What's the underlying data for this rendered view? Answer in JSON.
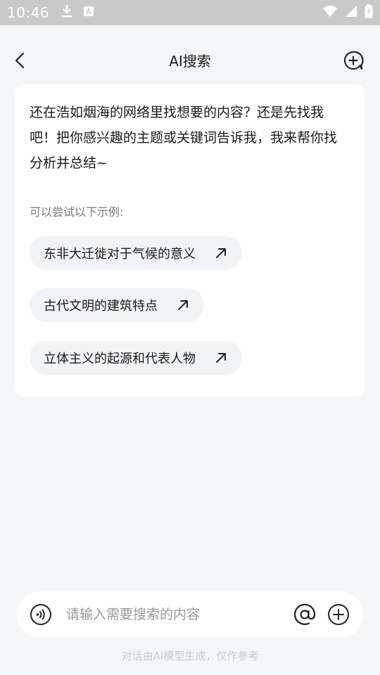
{
  "status_bar": {
    "time": "10:46",
    "icons": [
      "download-icon",
      "a-badge-icon",
      "wifi-icon",
      "signal-icon",
      "battery-icon"
    ]
  },
  "header": {
    "title": "AI搜索",
    "back_icon": "chevron-left-icon",
    "new_chat_icon": "chat-plus-icon"
  },
  "card": {
    "intro": "还在浩如烟海的网络里找想要的内容？还是先找我吧！把你感兴趣的主题或关键词告诉我，我来帮你找分析并总结~",
    "examples_label": "可以尝试以下示例:",
    "examples": [
      {
        "label": "东非大迁徙对于气候的意义"
      },
      {
        "label": "古代文明的建筑特点"
      },
      {
        "label": "立体主义的起源和代表人物"
      }
    ],
    "example_icon": "arrow-up-right-icon"
  },
  "input": {
    "placeholder": "请输入需要搜索的内容",
    "value": ""
  },
  "disclaimer": "对话由AI模型生成，仅作参考",
  "colors": {
    "background": "#f5f6f8",
    "card": "#ffffff",
    "chip": "#f2f3f5",
    "status_bar": "#c9c9c9"
  }
}
